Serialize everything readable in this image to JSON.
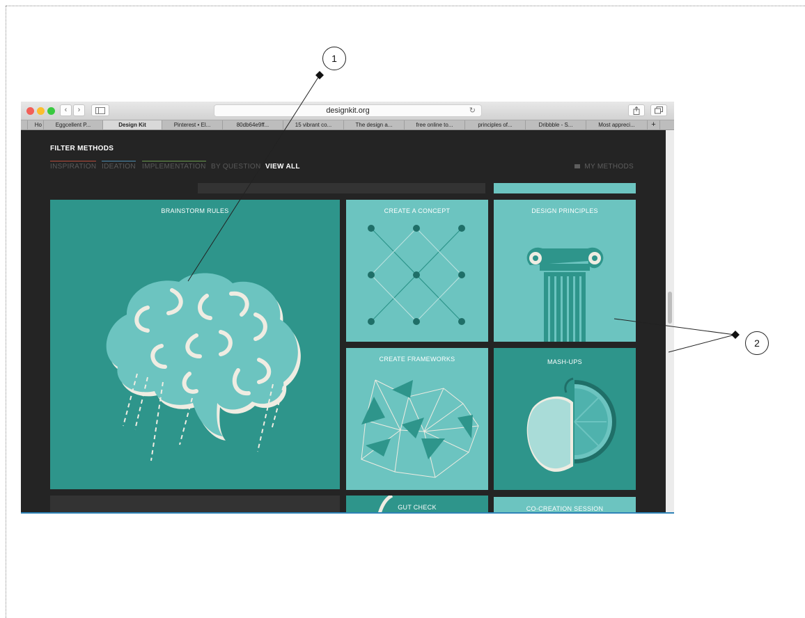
{
  "browser": {
    "url": "designkit.org",
    "tabs": [
      "Ho",
      "Eggcellent P...",
      "Design Kit",
      "Pinterest • El...",
      "80db64e9ff...",
      "15 vibrant co...",
      "The design a...",
      "free online to...",
      "principles of...",
      "Dribbble - S...",
      "Most appreci..."
    ],
    "active_tab": "Design Kit",
    "new_tab_label": "+"
  },
  "filter": {
    "title": "FILTER METHODS",
    "nav": [
      {
        "label": "INSPIRATION",
        "color": "#b74d3c"
      },
      {
        "label": "IDEATION",
        "color": "#4f8fb3"
      },
      {
        "label": "IMPLEMENTATION",
        "color": "#6b9a4f"
      },
      {
        "label": "BY QUESTION",
        "color": ""
      },
      {
        "label": "VIEW ALL",
        "color": ""
      }
    ],
    "my_methods": "MY METHODS"
  },
  "tiles": {
    "brainstorm": "BRAINSTORM RULES",
    "concept": "CREATE A CONCEPT",
    "principles": "DESIGN PRINCIPLES",
    "frameworks": "CREATE FRAMEWORKS",
    "mashups": "MASH-UPS",
    "gut_check": "GUT CHECK",
    "co_creation": "CO-CREATION SESSION"
  },
  "callouts": [
    "1",
    "2"
  ],
  "colors": {
    "teal_dark": "#2e958b",
    "teal_light": "#6cc4c0",
    "bg": "#242424"
  }
}
